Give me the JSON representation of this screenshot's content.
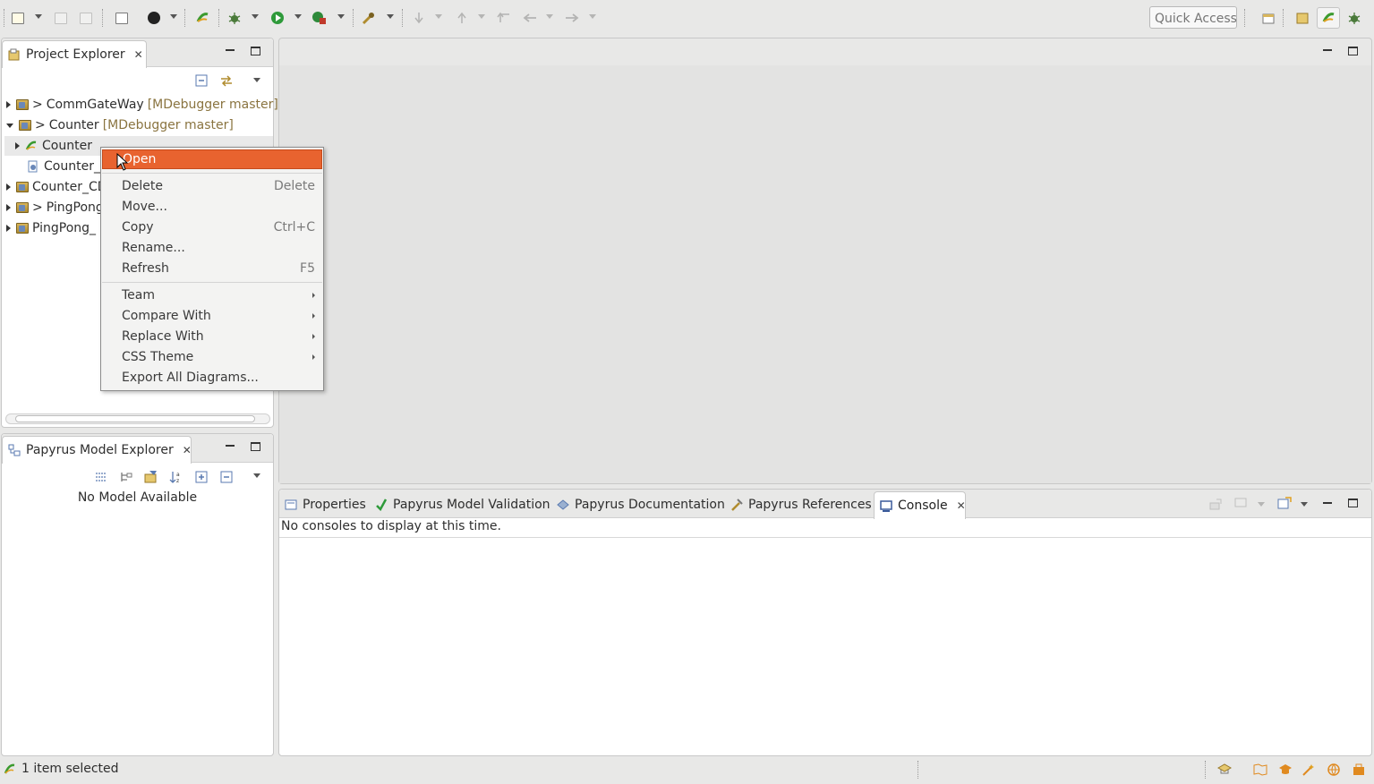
{
  "toolbar": {
    "quick_access_placeholder": "Quick Access"
  },
  "project_explorer": {
    "tab_label": "Project Explorer",
    "tree": [
      {
        "prefix": ">",
        "label": "CommGateWay",
        "decoration": "[MDebugger master]",
        "expanded": false
      },
      {
        "prefix": ">",
        "label": "Counter",
        "decoration": "[MDebugger master]",
        "expanded": true
      },
      {
        "prefix": "",
        "label": "Counter",
        "decoration": "",
        "expanded": false
      },
      {
        "prefix": "",
        "label": "Counter_",
        "decoration": "",
        "expanded": false
      },
      {
        "prefix": "",
        "label": "Counter_CD",
        "decoration": "",
        "expanded": false
      },
      {
        "prefix": ">",
        "label": "PingPong",
        "decoration": "",
        "expanded": false
      },
      {
        "prefix": "",
        "label": "PingPong_",
        "decoration": "",
        "expanded": false
      }
    ]
  },
  "context_menu": {
    "items": [
      {
        "label": "Open",
        "accel": "",
        "submenu": false,
        "highlighted": true
      },
      {
        "label": "Delete",
        "accel": "Delete",
        "submenu": false
      },
      {
        "label": "Move...",
        "accel": "",
        "submenu": false
      },
      {
        "label": "Copy",
        "accel": "Ctrl+C",
        "submenu": false
      },
      {
        "label": "Rename...",
        "accel": "",
        "submenu": false
      },
      {
        "label": "Refresh",
        "accel": "F5",
        "submenu": false
      },
      {
        "label": "Team",
        "accel": "",
        "submenu": true
      },
      {
        "label": "Compare With",
        "accel": "",
        "submenu": true
      },
      {
        "label": "Replace With",
        "accel": "",
        "submenu": true
      },
      {
        "label": "CSS Theme",
        "accel": "",
        "submenu": true
      },
      {
        "label": "Export All Diagrams...",
        "accel": "",
        "submenu": false
      }
    ]
  },
  "model_explorer": {
    "tab_label": "Papyrus Model Explorer",
    "empty_message": "No Model Available"
  },
  "bottom_panel": {
    "tabs": [
      {
        "label": "Properties",
        "icon": "properties-icon"
      },
      {
        "label": "Papyrus Model Validation",
        "icon": "checkmark-icon"
      },
      {
        "label": "Papyrus Documentation",
        "icon": "documentation-icon"
      },
      {
        "label": "Papyrus References",
        "icon": "references-icon"
      },
      {
        "label": "Console",
        "icon": "console-icon",
        "active": true
      }
    ],
    "console_message": "No consoles to display at this time."
  },
  "statusbar": {
    "selection_text": "1 item selected"
  },
  "colors": {
    "menu_highlight": "#e8632f",
    "decoration_text": "#8a7440",
    "window_bg": "#e8e8e7"
  }
}
